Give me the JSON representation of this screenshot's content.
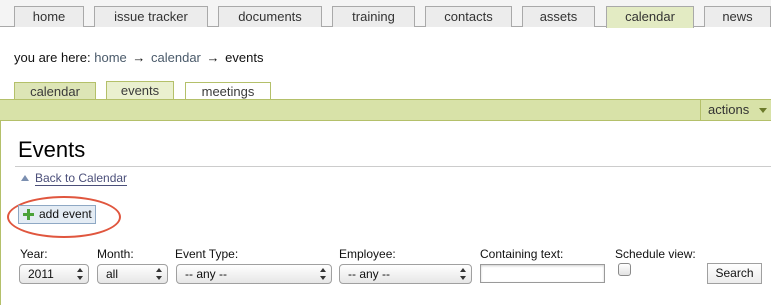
{
  "topnav": {
    "tabs": [
      {
        "label": "home"
      },
      {
        "label": "issue tracker"
      },
      {
        "label": "documents"
      },
      {
        "label": "training"
      },
      {
        "label": "contacts"
      },
      {
        "label": "assets"
      },
      {
        "label": "calendar",
        "active": true
      },
      {
        "label": "news"
      }
    ]
  },
  "breadcrumb": {
    "prefix": "you are here:",
    "items": [
      "home",
      "calendar",
      "events"
    ],
    "separator": "→"
  },
  "subtabs": {
    "tabs": [
      {
        "label": "calendar"
      },
      {
        "label": "events",
        "active": true
      },
      {
        "label": "meetings"
      }
    ],
    "actions_label": "actions"
  },
  "page": {
    "title": "Events",
    "back_link": "Back to Calendar",
    "add_event_label": "add event"
  },
  "filters": {
    "year": {
      "label": "Year:",
      "value": "2011"
    },
    "month": {
      "label": "Month:",
      "value": "all"
    },
    "event_type": {
      "label": "Event Type:",
      "value": "-- any --"
    },
    "employee": {
      "label": "Employee:",
      "value": "-- any --"
    },
    "containing_text": {
      "label": "Containing text:",
      "value": ""
    },
    "schedule_view": {
      "label": "Schedule view:",
      "checked": false
    },
    "search_label": "Search"
  },
  "colors": {
    "accent_green": "#d8e2a8",
    "highlight_red": "#e0563e"
  }
}
